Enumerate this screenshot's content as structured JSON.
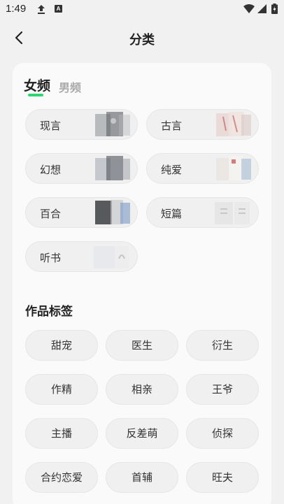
{
  "status_bar": {
    "time": "1:49",
    "notification_letter": "A",
    "icons": [
      "upload-icon",
      "app-a-icon",
      "wifi-icon",
      "signal-icon",
      "battery-icon"
    ]
  },
  "header": {
    "title": "分类",
    "back_icon": "chevron-left-icon"
  },
  "tabs": [
    {
      "label": "女频",
      "active": true
    },
    {
      "label": "男频",
      "active": false
    }
  ],
  "colors": {
    "accent": "#2ed573",
    "card_bg": "#fafafa",
    "pill_bg": "#f0f0f0",
    "page_bg": "#f1f1f1"
  },
  "categories": [
    {
      "label": "现言"
    },
    {
      "label": "古言"
    },
    {
      "label": "幻想"
    },
    {
      "label": "纯爱"
    },
    {
      "label": "百合"
    },
    {
      "label": "短篇"
    },
    {
      "label": "听书"
    }
  ],
  "tags_section": {
    "title": "作品标签",
    "tags": [
      "甜宠",
      "医生",
      "衍生",
      "作精",
      "相亲",
      "王爷",
      "主播",
      "反差萌",
      "侦探",
      "合约恋爱",
      "首辅",
      "旺夫"
    ]
  }
}
